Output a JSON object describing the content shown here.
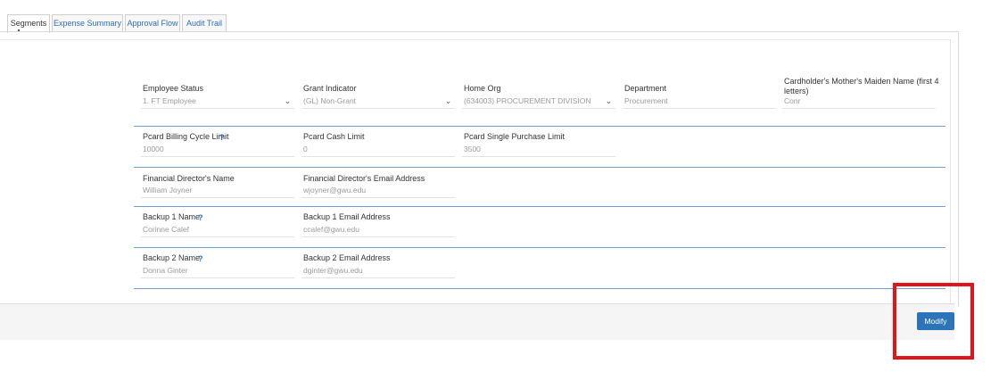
{
  "tabs": [
    {
      "label": "Segments",
      "active": true
    },
    {
      "label": "Expense Summary",
      "active": false
    },
    {
      "label": "Approval Flow",
      "active": false
    },
    {
      "label": "Audit Trail",
      "active": false
    }
  ],
  "row1": {
    "employee_status": {
      "label": "Employee Status",
      "value": "1. FT Employee"
    },
    "grant_indicator": {
      "label": "Grant Indicator",
      "value": "(GL) Non-Grant"
    },
    "home_org": {
      "label": "Home Org",
      "value": "(634003) PROCUREMENT DIVISION"
    },
    "department": {
      "label": "Department",
      "value": "Procurement"
    },
    "maiden_name": {
      "label": "Cardholder's Mother's Maiden Name (first 4 letters)",
      "value": "Conr"
    }
  },
  "row2": {
    "billing_limit": {
      "label": "Pcard Billing Cycle Limit",
      "value": "10000"
    },
    "cash_limit": {
      "label": "Pcard Cash Limit",
      "value": "0"
    },
    "single_purchase_limit": {
      "label": "Pcard Single Purchase Limit",
      "value": "3500"
    }
  },
  "row3": {
    "fd_name": {
      "label": "Financial Director's Name",
      "value": "William Joyner"
    },
    "fd_email": {
      "label": "Financial Director's Email Address",
      "value": "wjoyner@gwu.edu"
    }
  },
  "row4": {
    "b1_name": {
      "label": "Backup 1 Name",
      "value": "Corinne Calef"
    },
    "b1_email": {
      "label": "Backup 1 Email Address",
      "value": "ccalef@gwu.edu"
    }
  },
  "row5": {
    "b2_name": {
      "label": "Backup 2 Name",
      "value": "Donna Ginter"
    },
    "b2_email": {
      "label": "Backup 2 Email Address",
      "value": "dginter@gwu.edu"
    }
  },
  "help_glyph": "?",
  "chevron_glyph": "⌄",
  "buttons": {
    "modify": "Modify"
  },
  "colors": {
    "accent": "#2b74b8",
    "highlight": "#e0141b"
  }
}
